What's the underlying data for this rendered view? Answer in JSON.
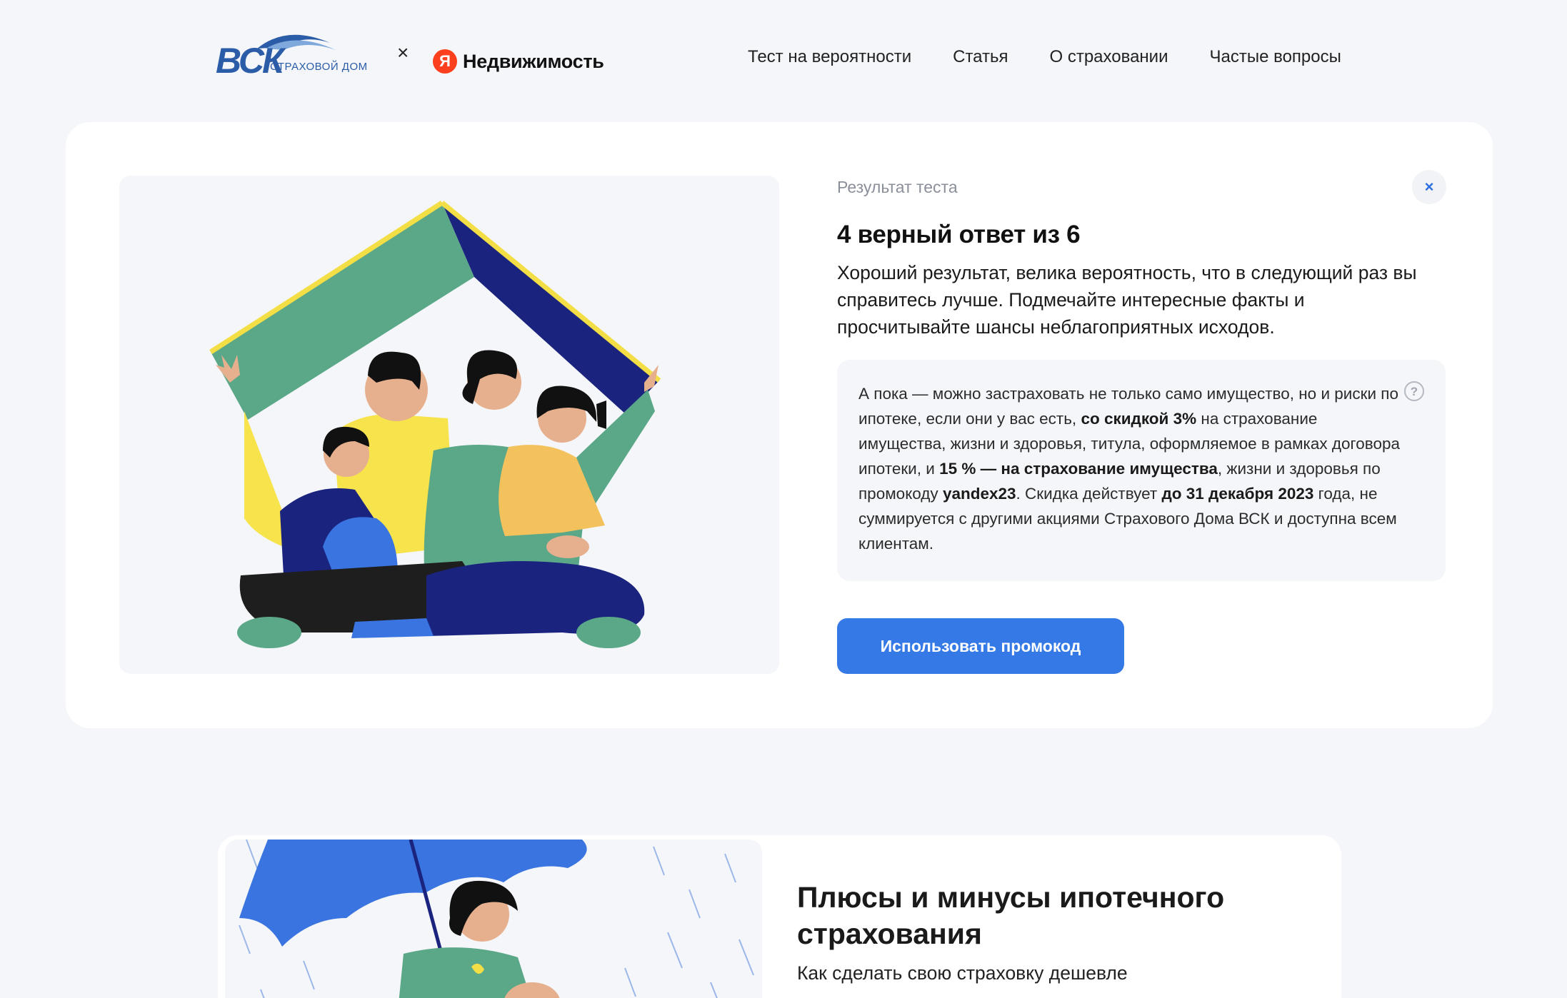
{
  "header": {
    "vsk_logo_letters": "ВСК",
    "vsk_logo_subtitle": "СТРАХОВОЙ ДОМ",
    "cross_sign": "×",
    "yandex_logo_letter": "Я",
    "yandex_logo_text": "Недвижимость",
    "nav": [
      {
        "label": "Тест на вероятности"
      },
      {
        "label": "Статья"
      },
      {
        "label": "О страховании"
      },
      {
        "label": "Частые вопросы"
      }
    ]
  },
  "result": {
    "label": "Результат теста",
    "close_icon": "×",
    "score": "4 верный ответ из 6",
    "description": "Хороший результат, велика вероятность, что в следующий раз вы справитесь лучше. Подмечайте интересные факты и просчитывайте шансы неблагоприятных исходов.",
    "promo": {
      "t1": "А пока — можно застраховать не только само имущество, но и риски по ипотеке, если они у вас есть, ",
      "b1": "со скидкой 3%",
      "t2": " на страхование имущества, жизни и здоровья, титула, оформляемое в рамках договора ипотеки, и ",
      "b2": "15 % — на страхование имущества",
      "t3": ", жизни и здоровья по промокоду ",
      "b3": "yandex23",
      "t4": ". Скидка действует ",
      "b4": "до 31 декабря 2023",
      "t5": " года, не суммируется с другими акциями Страхового Дома ВСК и доступна всем клиентам.",
      "help_icon": "?"
    },
    "button_label": "Использовать промокод"
  },
  "article": {
    "title": "Плюсы и минусы ипотечного страхования",
    "subtitle": "Как сделать свою страховку дешевле"
  },
  "colors": {
    "accent": "#3579e6",
    "page_bg": "#f5f6f9",
    "card_bg": "#ffffff",
    "roof_green": "#5ba888",
    "roof_navy": "#1a237e",
    "roof_edge": "#f3df45"
  }
}
